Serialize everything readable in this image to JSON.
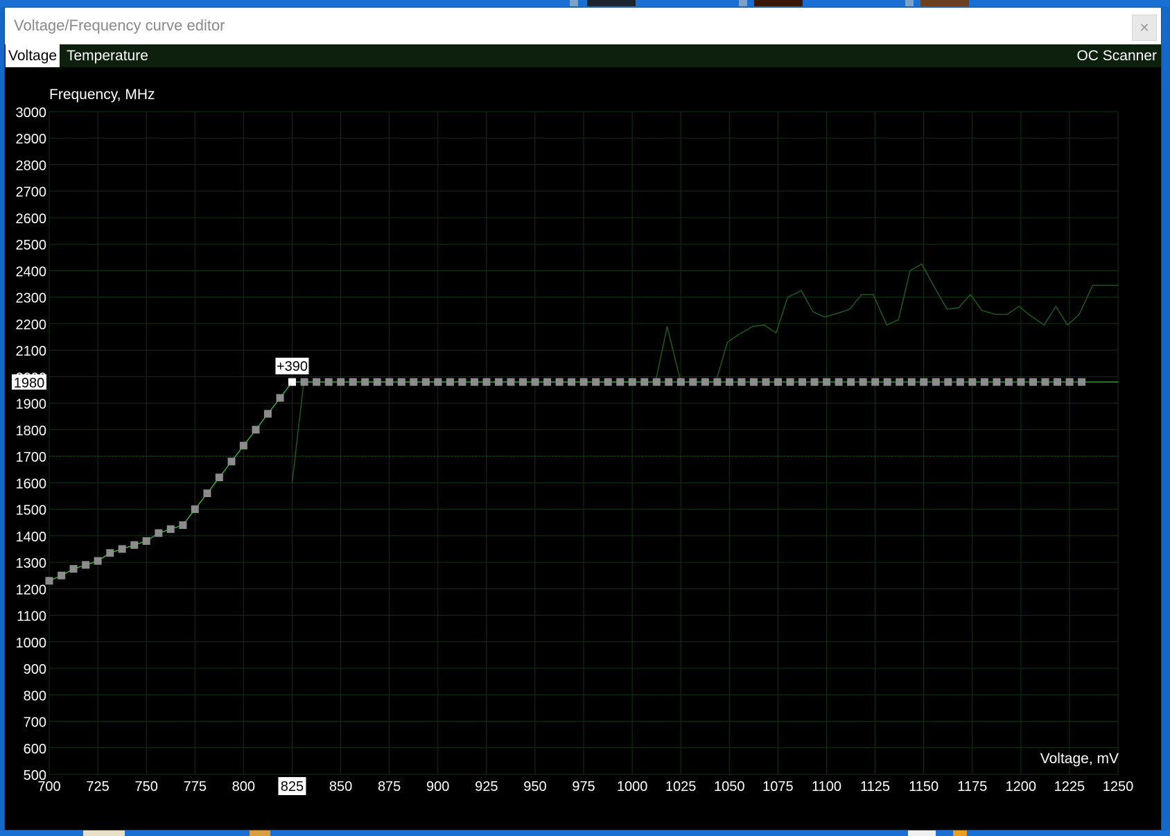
{
  "window": {
    "title": "Voltage/Frequency curve editor",
    "close_glyph": "✕"
  },
  "tabs": {
    "voltage": "Voltage",
    "temperature": "Temperature",
    "oc_scanner": "OC Scanner"
  },
  "colors": {
    "background": "#000000",
    "tabbar": "#0d1f0d",
    "grid": "#123212",
    "curve_line": "#3ad43a",
    "point": "#8c8c8c",
    "selected_point": "#ffffff",
    "reference_line": "#1d5a1d",
    "desktop": "#1469c8"
  },
  "chart_data": {
    "type": "line",
    "ylabel": "Frequency, MHz",
    "xlabel": "Voltage, mV",
    "xlim": [
      700,
      1250
    ],
    "ylim": [
      500,
      3000
    ],
    "x_ticks": [
      700,
      725,
      750,
      775,
      800,
      825,
      850,
      875,
      900,
      925,
      950,
      975,
      1000,
      1025,
      1050,
      1075,
      1100,
      1125,
      1150,
      1175,
      1200,
      1225,
      1250
    ],
    "y_ticks": [
      500,
      600,
      700,
      800,
      900,
      1000,
      1100,
      1200,
      1300,
      1400,
      1500,
      1600,
      1700,
      1800,
      1900,
      2000,
      2100,
      2200,
      2300,
      2400,
      2500,
      2600,
      2700,
      2800,
      2900,
      3000
    ],
    "grid": true,
    "selected_point": {
      "voltage": 825,
      "frequency": 1980,
      "offset_label": "+390",
      "voltage_label": "825",
      "frequency_label": "1980"
    },
    "reference_line_frequency": 1700,
    "series": [
      {
        "role": "curve",
        "x": [
          700,
          706.3,
          712.5,
          718.8,
          725,
          731.3,
          737.5,
          743.8,
          750,
          756.3,
          762.5,
          768.8,
          775,
          781.3,
          787.5,
          793.8,
          800,
          806.3,
          812.5,
          818.8,
          825
        ],
        "y": [
          1230,
          1250,
          1275,
          1290,
          1305,
          1335,
          1350,
          1365,
          1380,
          1410,
          1425,
          1440,
          1500,
          1560,
          1620,
          1680,
          1740,
          1800,
          1860,
          1920,
          1980
        ]
      },
      {
        "role": "flat",
        "x_start": 831.3,
        "x_end": 1237.5,
        "step": 6.25,
        "y": 1980,
        "line_end_x": 1250
      },
      {
        "role": "reference",
        "x": [
          825,
          831,
          1012,
          1018,
          1025,
          1043,
          1049,
          1055,
          1062,
          1068,
          1074,
          1080,
          1087,
          1093,
          1099,
          1106,
          1112,
          1118,
          1124,
          1131,
          1137,
          1143,
          1149,
          1155,
          1162,
          1168,
          1174,
          1180,
          1187,
          1193,
          1199,
          1205,
          1212,
          1218,
          1224,
          1230,
          1237,
          1243,
          1250
        ],
        "y": [
          1600,
          1980,
          1980,
          2190,
          1980,
          1980,
          2130,
          2160,
          2190,
          2195,
          2165,
          2300,
          2325,
          2245,
          2225,
          2240,
          2255,
          2310,
          2310,
          2195,
          2215,
          2400,
          2425,
          2345,
          2255,
          2260,
          2310,
          2250,
          2235,
          2235,
          2265,
          2230,
          2195,
          2265,
          2195,
          2235,
          2345,
          2345,
          2345
        ]
      }
    ]
  }
}
